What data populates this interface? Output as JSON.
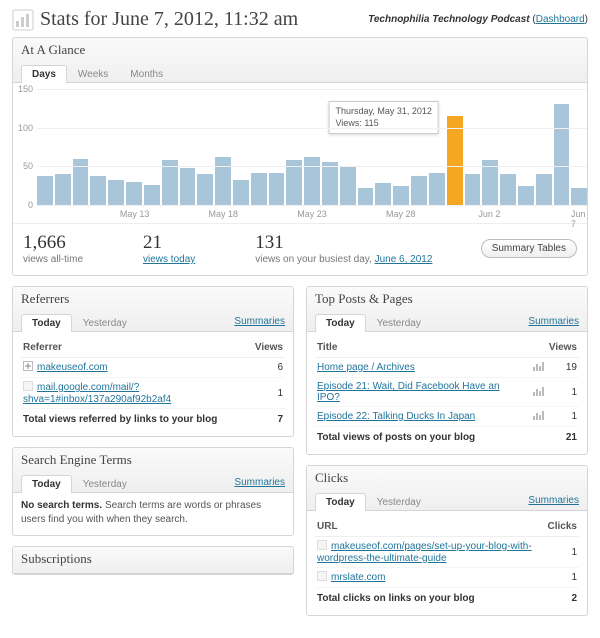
{
  "header": {
    "title": "Stats for June 7, 2012, 11:32 am",
    "site_name": "Technophilia Technology Podcast",
    "dashboard_link": "Dashboard"
  },
  "glance": {
    "title": "At A Glance",
    "tabs": {
      "days": "Days",
      "weeks": "Weeks",
      "months": "Months"
    },
    "tooltip_date": "Thursday, May 31, 2012",
    "tooltip_views_label": "Views:",
    "tooltip_views": "115",
    "stats": {
      "all_time_num": "1,666",
      "all_time_label": "views all-time",
      "today_num": "21",
      "today_label": "views today",
      "busiest_num": "131",
      "busiest_label_prefix": "views on your busiest day,",
      "busiest_date": "June 6, 2012"
    },
    "summary_button": "Summary Tables"
  },
  "chart_data": {
    "type": "bar",
    "ylabel": "",
    "ylim": [
      0,
      150
    ],
    "yticks": [
      0,
      50,
      100,
      150
    ],
    "x_tick_labels": [
      "May 13",
      "May 18",
      "May 23",
      "May 28",
      "Jun 2",
      "Jun 7"
    ],
    "x_tick_indices": [
      5,
      10,
      15,
      20,
      25,
      30
    ],
    "highlight_index": 23,
    "weekend_indices": [
      4,
      5,
      11,
      12,
      18,
      19,
      25,
      26
    ],
    "categories": [
      "May 8",
      "May 9",
      "May 10",
      "May 11",
      "May 12",
      "May 13",
      "May 14",
      "May 15",
      "May 16",
      "May 17",
      "May 18",
      "May 19",
      "May 20",
      "May 21",
      "May 22",
      "May 23",
      "May 24",
      "May 25",
      "May 26",
      "May 27",
      "May 28",
      "May 29",
      "May 30",
      "May 31",
      "Jun 1",
      "Jun 2",
      "Jun 3",
      "Jun 4",
      "Jun 5",
      "Jun 6",
      "Jun 7"
    ],
    "values": [
      38,
      40,
      60,
      38,
      32,
      30,
      26,
      58,
      48,
      40,
      62,
      32,
      42,
      42,
      58,
      62,
      55,
      50,
      22,
      28,
      24,
      38,
      42,
      115,
      40,
      58,
      40,
      24,
      40,
      131,
      22
    ]
  },
  "referrers": {
    "title": "Referrers",
    "tabs": {
      "today": "Today",
      "yesterday": "Yesterday"
    },
    "summaries": "Summaries",
    "col_referrer": "Referrer",
    "col_views": "Views",
    "rows": [
      {
        "label": "makeuseof.com",
        "views": 6,
        "expandable": true
      },
      {
        "label": "mail.google.com/mail/?shva=1#inbox/137a290af92b2af4",
        "views": 1,
        "expandable": false
      }
    ],
    "total_label": "Total views referred by links to your blog",
    "total_value": 7
  },
  "top_posts": {
    "title": "Top Posts & Pages",
    "tabs": {
      "today": "Today",
      "yesterday": "Yesterday"
    },
    "summaries": "Summaries",
    "col_title": "Title",
    "col_views": "Views",
    "rows": [
      {
        "label": "Home page / Archives",
        "views": 19
      },
      {
        "label": "Episode 21: Wait, Did Facebook Have an IPO?",
        "views": 1
      },
      {
        "label": "Episode 22: Talking Ducks In Japan",
        "views": 1
      }
    ],
    "total_label": "Total views of posts on your blog",
    "total_value": 21
  },
  "search_terms": {
    "title": "Search Engine Terms",
    "tabs": {
      "today": "Today",
      "yesterday": "Yesterday"
    },
    "summaries": "Summaries",
    "empty_bold": "No search terms.",
    "empty_rest": "Search terms are words or phrases users find you with when they search."
  },
  "clicks": {
    "title": "Clicks",
    "tabs": {
      "today": "Today",
      "yesterday": "Yesterday"
    },
    "summaries": "Summaries",
    "col_url": "URL",
    "col_clicks": "Clicks",
    "rows": [
      {
        "label": "makeuseof.com/pages/set-up-your-blog-with-wordpress-the-ultimate-guide",
        "clicks": 1
      },
      {
        "label": "mrslate.com",
        "clicks": 1
      }
    ],
    "total_label": "Total clicks on links on your blog",
    "total_value": 2
  },
  "subscriptions": {
    "title": "Subscriptions"
  },
  "colors": {
    "bar": "#a8c5d9",
    "highlight": "#f5a623",
    "link": "#21759b"
  }
}
